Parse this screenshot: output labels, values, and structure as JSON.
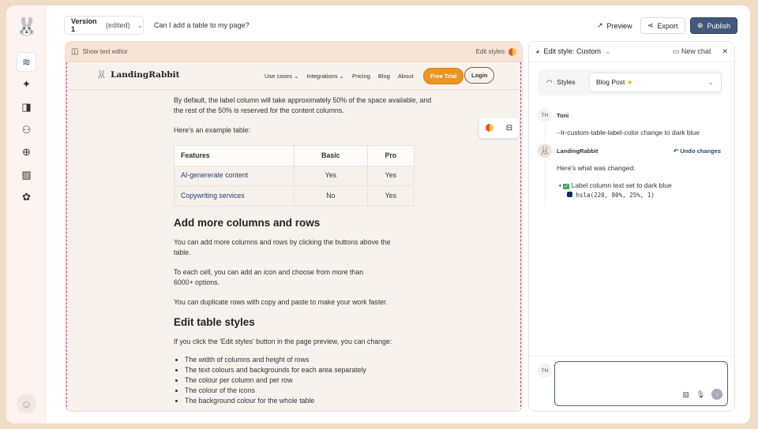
{
  "sidebar": {
    "items": [
      "layers",
      "sparkles",
      "brush",
      "users",
      "globe",
      "image",
      "puzzle"
    ]
  },
  "topbar": {
    "version": "Version 1",
    "edited": "(edited)",
    "question": "Can I add a table to my page?",
    "preview": "Preview",
    "export": "Export",
    "publish": "Publish"
  },
  "preview": {
    "show_text_editor": "Show text editor",
    "edit_styles": "Edit styles",
    "nav": {
      "brand": "LandingRabbit",
      "links": [
        "Use cases",
        "Integrations",
        "Pricing",
        "Blog",
        "About"
      ],
      "free_trial": "Free Trial",
      "login": "Login"
    },
    "doc": {
      "p1": "By default, the label column will take approximately 50% of the space available, and the rest of the 50% is reserved for the content columns.",
      "p2": "Here's an example table:",
      "table": {
        "headers": [
          "Features",
          "Basic",
          "Pro"
        ],
        "rows": [
          [
            "AI-genererate content",
            "Yes",
            "Yes"
          ],
          [
            "Copywriting services",
            "No",
            "Yes"
          ]
        ]
      },
      "h1": "Add more columns and rows",
      "p3": "You can add more columns and rows by clicking the buttons above the table.",
      "p4": "To each cell, you can add an icon and choose from more than 6000+ options.",
      "p5": "You can duplicate rows with copy and paste to make your work faster.",
      "h2": "Edit table styles",
      "p6": "If you click the 'Edit styles' button in the page preview, you can change:",
      "list": [
        "The width of columns and height of rows",
        "The text colours and backgrounds for each area separately",
        "The colour per column and per row",
        "The colour of the icons",
        "The background colour for the whole table"
      ]
    }
  },
  "chat": {
    "title": "Edit style: Custom",
    "new_chat": "New chat",
    "styles_label": "Styles",
    "styles_value": "Blog Post",
    "user_initials": "TH",
    "user_name": "Toni",
    "user_msg": "--lr-custom-table-label-color change to dark blue",
    "bot_name": "LandingRabbit",
    "undo": "Undo changes",
    "bot_intro": "Here's what was changed:",
    "change": "Label column text set to dark blue",
    "color_value": "hsla(220, 80%, 25%, 1)",
    "color_swatch": "#0d2a6e"
  }
}
